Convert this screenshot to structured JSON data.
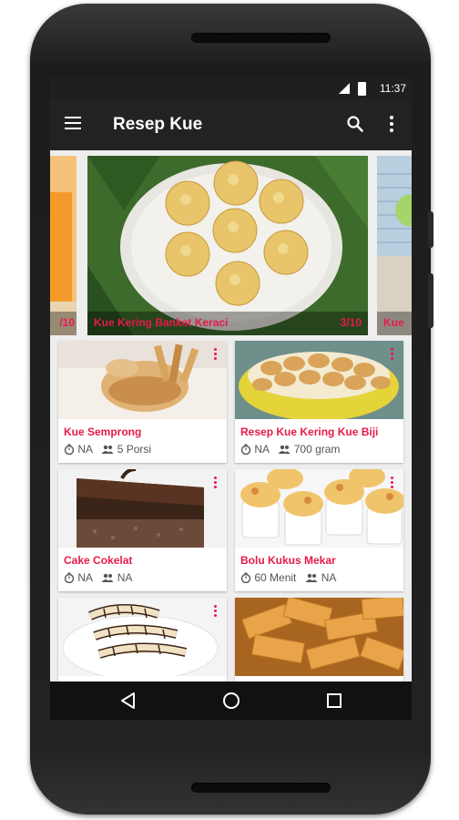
{
  "status": {
    "time": "11:37"
  },
  "appbar": {
    "title": "Resep Kue",
    "menu_icon": "hamburger-menu-icon",
    "search_icon": "search-icon",
    "overflow_icon": "more-vert-icon"
  },
  "carousel": {
    "left_count": "/10",
    "main": {
      "title": "Kue Kering Banket Keraci",
      "count": "3/10"
    },
    "right_title": "Kue"
  },
  "recipes": [
    {
      "name": "Kue Semprong",
      "time": "NA",
      "serving": "5 Porsi"
    },
    {
      "name": "Resep Kue Kering Kue Biji",
      "time": "NA",
      "serving": "700 gram"
    },
    {
      "name": "Cake Cokelat",
      "time": "NA",
      "serving": "NA"
    },
    {
      "name": "Bolu Kukus Mekar",
      "time": "60 Menit",
      "serving": "NA"
    },
    {
      "name": "",
      "time": "",
      "serving": ""
    },
    {
      "name": "",
      "time": "",
      "serving": ""
    }
  ],
  "colors": {
    "accent": "#e8194b",
    "appbar": "#222222",
    "background": "#eeeeee"
  },
  "navbar": {
    "back_icon": "back-triangle-icon",
    "home_icon": "home-circle-icon",
    "recents_icon": "recents-square-icon"
  }
}
